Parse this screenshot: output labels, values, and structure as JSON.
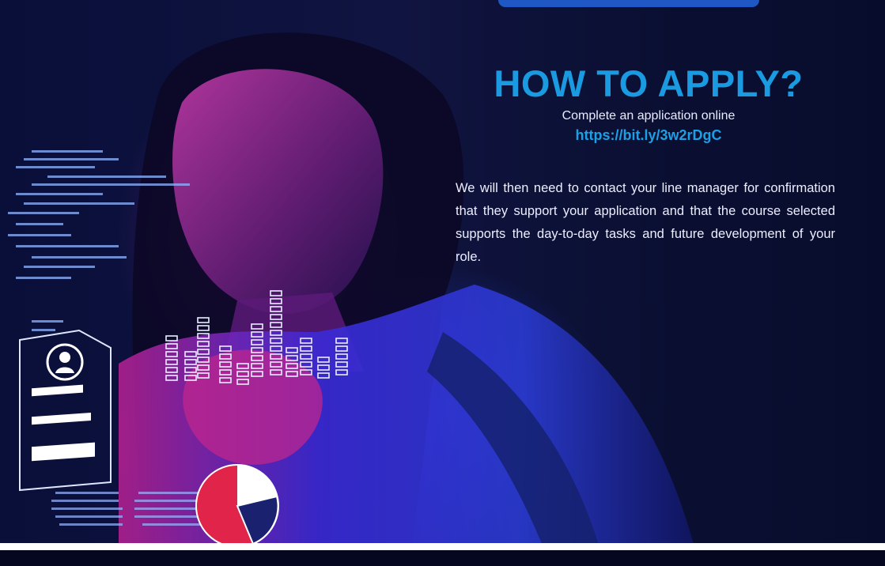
{
  "apply": {
    "title": "HOW TO APPLY?",
    "subtitle": "Complete an application online",
    "link": "https://bit.ly/3w2rDgC",
    "body": "We will then need to contact your line manager for confirmation that they support your application and that the course selected supports the day-to-day tasks and future development of your role."
  },
  "colors": {
    "background": "#070b2e",
    "accent": "#1a9ae0",
    "text": "#eceeff",
    "bar": "#ffffff"
  },
  "hero": {
    "subject": "woman-at-screen-image",
    "overlay_icons": [
      "data-text-icon",
      "profile-card-icon",
      "equalizer-bars-icon",
      "pie-chart-icon"
    ]
  }
}
